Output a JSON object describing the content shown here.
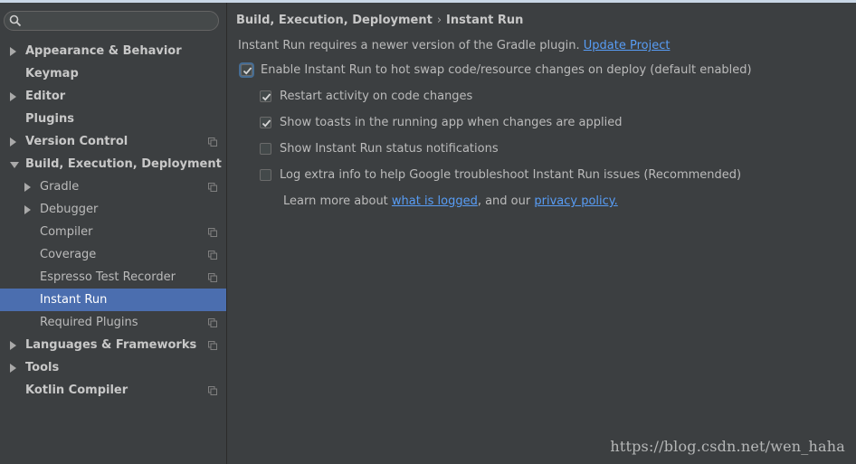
{
  "search": {
    "placeholder": "",
    "value": ""
  },
  "sidebar": {
    "items": [
      {
        "label": "Appearance & Behavior",
        "level": 0,
        "arrow": "right",
        "copy": false
      },
      {
        "label": "Keymap",
        "level": 0,
        "arrow": "none",
        "copy": false
      },
      {
        "label": "Editor",
        "level": 0,
        "arrow": "right",
        "copy": false
      },
      {
        "label": "Plugins",
        "level": 0,
        "arrow": "none",
        "copy": false
      },
      {
        "label": "Version Control",
        "level": 0,
        "arrow": "right",
        "copy": true
      },
      {
        "label": "Build, Execution, Deployment",
        "level": 0,
        "arrow": "down",
        "copy": false
      },
      {
        "label": "Gradle",
        "level": 1,
        "arrow": "right",
        "copy": true
      },
      {
        "label": "Debugger",
        "level": 1,
        "arrow": "right",
        "copy": false
      },
      {
        "label": "Compiler",
        "level": 1,
        "arrow": "none",
        "copy": true
      },
      {
        "label": "Coverage",
        "level": 1,
        "arrow": "none",
        "copy": true
      },
      {
        "label": "Espresso Test Recorder",
        "level": 1,
        "arrow": "none",
        "copy": true
      },
      {
        "label": "Instant Run",
        "level": 1,
        "arrow": "none",
        "copy": false,
        "selected": true
      },
      {
        "label": "Required Plugins",
        "level": 1,
        "arrow": "none",
        "copy": true
      },
      {
        "label": "Languages & Frameworks",
        "level": 0,
        "arrow": "right",
        "copy": true
      },
      {
        "label": "Tools",
        "level": 0,
        "arrow": "right",
        "copy": false
      },
      {
        "label": "Kotlin Compiler",
        "level": 0,
        "arrow": "none",
        "copy": true
      }
    ]
  },
  "breadcrumb": {
    "parent": "Build, Execution, Deployment",
    "separator": "›",
    "current": "Instant Run"
  },
  "gradle_notice": {
    "text": "Instant Run requires a newer version of the Gradle plugin.",
    "link": "Update Project"
  },
  "options": {
    "enable_instant_run": {
      "label": "Enable Instant Run to hot swap code/resource changes on deploy (default enabled)",
      "checked": true
    },
    "restart_activity": {
      "label": "Restart activity on code changes",
      "checked": true
    },
    "show_toasts": {
      "label": "Show toasts in the running app when changes are applied",
      "checked": true
    },
    "status_notifications": {
      "label": "Show Instant Run status notifications",
      "checked": false
    },
    "log_extra_info": {
      "label": "Log extra info to help Google troubleshoot Instant Run issues (Recommended)",
      "checked": false
    }
  },
  "learn_more": {
    "prefix": "Learn more about",
    "link1": "what is logged",
    "middle": ", and our",
    "link2": "privacy policy."
  },
  "watermark": "https://blog.csdn.net/wen_haha",
  "colors": {
    "background": "#3c3f41",
    "selection": "#4b6eaf",
    "link": "#589df6",
    "text": "#bbbbbb"
  }
}
